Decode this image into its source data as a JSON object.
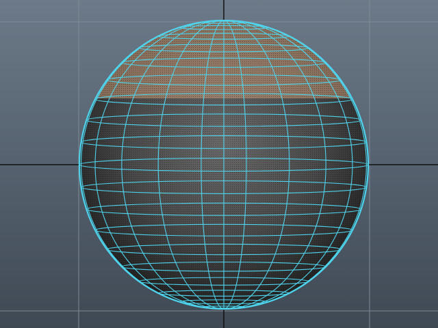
{
  "viewport": {
    "kind": "3d-perspective-viewport",
    "background_top": "#6c7a89",
    "background_bottom": "#3f4954",
    "grid_color": "#7f8a96",
    "axis_color": "#111111"
  },
  "sphere": {
    "object": "polySphere",
    "subdivisions_axis": 20,
    "subdivisions_height": 20,
    "wireframe_color": "#4fd4ee",
    "shade_light": "#6a6a6a",
    "shade_dark": "#1e1e1e",
    "selected_faces_color": "#c79a78",
    "selected_face_rows": "top four rows",
    "face_dots": true
  }
}
